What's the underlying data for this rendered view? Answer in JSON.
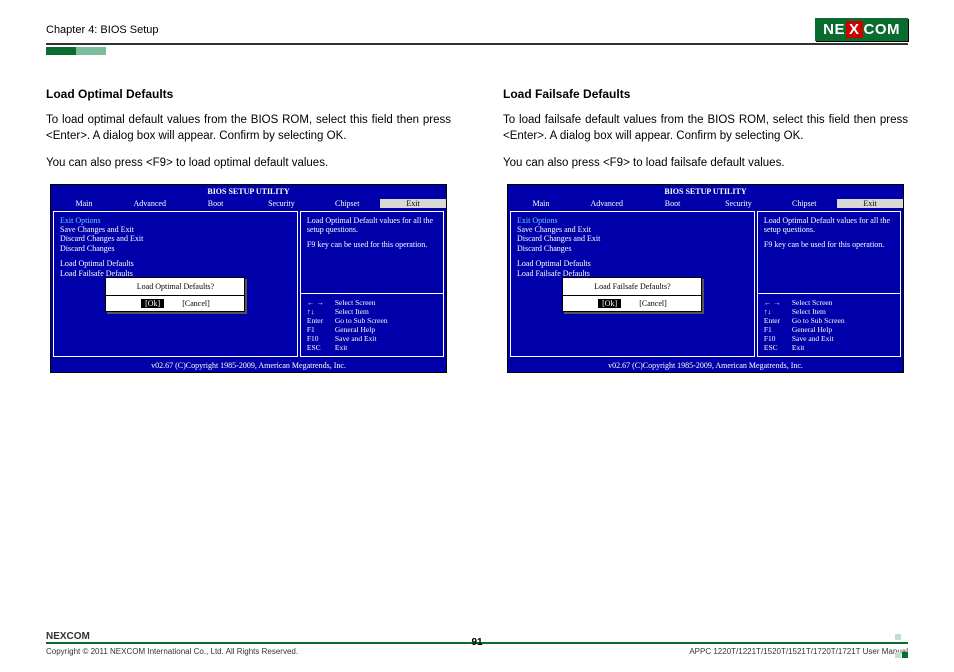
{
  "header": {
    "chapter": "Chapter 4: BIOS Setup",
    "logo_pre": "NE",
    "logo_x": "X",
    "logo_post": "COM"
  },
  "left": {
    "title": "Load Optimal Defaults",
    "p1": "To load optimal default values from the BIOS ROM, select this field then press <Enter>. A dialog box will appear. Confirm by selecting OK.",
    "p2": "You can also press <F9> to load optimal default values."
  },
  "right": {
    "title": "Load Failsafe Defaults",
    "p1": "To load failsafe default values from the BIOS ROM, select this field then press <Enter>. A dialog box will appear. Confirm by selecting OK.",
    "p2": "You can also press <F9> to load failsafe default values."
  },
  "bios": {
    "title": "BIOS SETUP UTILITY",
    "menu": [
      "Main",
      "Advanced",
      "Boot",
      "Security",
      "Chipset",
      "Exit"
    ],
    "exit_heading": "Exit Options",
    "items": [
      "Save Changes and Exit",
      "Discard Changes and Exit",
      "Discard Changes"
    ],
    "items2": [
      "Load Optimal Defaults",
      "Load Failsafe Defaults"
    ],
    "help_top": "Load Optimal Default values for all the setup questions.",
    "help_top2": "F9 key can be used for this operation.",
    "nav": [
      {
        "k": "← →",
        "v": "Select Screen"
      },
      {
        "k": "↑↓",
        "v": "Select Item"
      },
      {
        "k": "Enter",
        "v": "Go to Sub Screen"
      },
      {
        "k": "F1",
        "v": "General Help"
      },
      {
        "k": "F10",
        "v": "Save and Exit"
      },
      {
        "k": "ESC",
        "v": "Exit"
      }
    ],
    "foot": "v02.67 (C)Copyright 1985-2009, American Megatrends, Inc.",
    "dialog_left": "Load Optimal Defaults?",
    "dialog_right": "Load Failsafe Defaults?",
    "ok": "[Ok]",
    "cancel": "[Cancel]"
  },
  "footer": {
    "logo": "NEXCOM",
    "copy": "Copyright © 2011 NEXCOM International Co., Ltd. All Rights Reserved.",
    "page": "91",
    "doc": "APPC 1220T/1221T/1520T/1521T/1720T/1721T User Manual"
  }
}
